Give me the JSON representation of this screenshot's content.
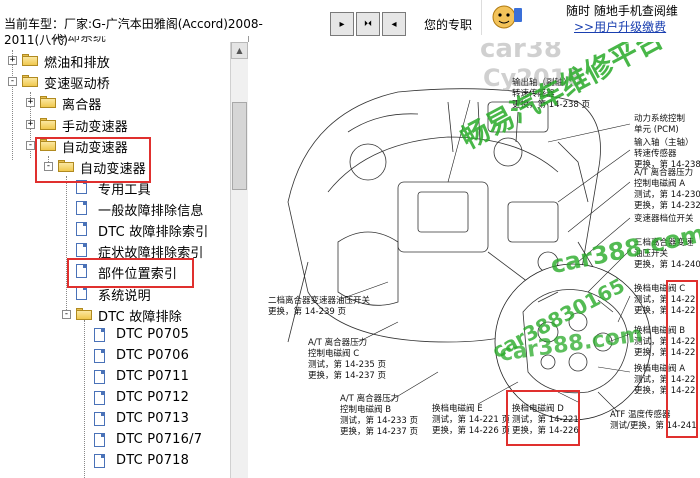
{
  "header": {
    "car_model_prefix": "当前车型：",
    "car_model_name": "厂家:G-广汽本田雅阁(Accord)2008-",
    "car_model_cont": "2011(八代)",
    "pro_text": "您的专职",
    "toolbar": [
      {
        "icon": "arrow-right-icon",
        "glyph": "▸"
      },
      {
        "icon": "double-arrow-icon",
        "glyph": "⏵⏴"
      },
      {
        "icon": "arrow-left-icon",
        "glyph": "◂"
      }
    ]
  },
  "banner": {
    "line1": "随时 随地手机查阅维",
    "link": ">>用户升级缴费"
  },
  "tree": [
    {
      "id": "fuel",
      "label": "燃油和排放",
      "type": "folder",
      "toggle": "+"
    },
    {
      "id": "drivetrain",
      "label": "变速驱动桥",
      "type": "folder",
      "toggle": "-"
    },
    {
      "id": "clutch",
      "label": "离合器",
      "type": "folder",
      "toggle": "+"
    },
    {
      "id": "manual",
      "label": "手动变速器",
      "type": "folder",
      "toggle": "+"
    },
    {
      "id": "auto",
      "label": "自动变速器",
      "type": "folder",
      "toggle": "-"
    },
    {
      "id": "auto-sub",
      "label": "自动变速器",
      "type": "folder",
      "toggle": "-"
    },
    {
      "id": "tools",
      "label": "专用工具",
      "type": "doc"
    },
    {
      "id": "general",
      "label": "一般故障排除信息",
      "type": "doc"
    },
    {
      "id": "dtc-index",
      "label": "DTC 故障排除索引",
      "type": "doc"
    },
    {
      "id": "symptom-index",
      "label": "症状故障排除索引",
      "type": "doc"
    },
    {
      "id": "parts-index",
      "label": "部件位置索引",
      "type": "doc"
    },
    {
      "id": "system",
      "label": "系统说明",
      "type": "doc"
    },
    {
      "id": "dtc-troubleshoot",
      "label": "DTC 故障排除",
      "type": "folder",
      "toggle": "-"
    },
    {
      "id": "p0705",
      "label": "DTC P0705",
      "type": "doc"
    },
    {
      "id": "p0706",
      "label": "DTC P0706",
      "type": "doc"
    },
    {
      "id": "p0711",
      "label": "DTC P0711",
      "type": "doc"
    },
    {
      "id": "p0712",
      "label": "DTC P0712",
      "type": "doc"
    },
    {
      "id": "p0713",
      "label": "DTC P0713",
      "type": "doc"
    },
    {
      "id": "p0716",
      "label": "DTC P0716/7",
      "type": "doc"
    },
    {
      "id": "p0718",
      "label": "DTC P0718",
      "type": "doc"
    }
  ],
  "diagram": {
    "labels": {
      "l1": "输出轴（副轴）\n转速传感器\n更换，第 14-238 页",
      "l2": "动力系统控制\n单元 (PCM)",
      "l3": "输入轴（主轴）\n转速传感器\n更换，第 14-238",
      "l4": "A/T 离合器压力\n控制电磁阀 A\n测试，第 14-230\n更换，第 14-232",
      "l5": "变速器档位开关",
      "l6": "三档离合器变速\n油压开关\n更换，第 14-240",
      "l7": "二档离合器变速器油压开关\n更换，第 14-239 页",
      "l8": "A/T 离合器压力\n控制电磁阀 C\n测试，第 14-235 页\n更换，第 14-237 页",
      "l9": "A/T 离合器压力\n控制电磁阀 B\n测试，第 14-233 页\n更换，第 14-237 页",
      "l10": "换档电磁阀 E\n测试，第 14-221 页\n更换，第 14-226 页",
      "l11": "换档电磁阀 D\n测试，第 14-221\n更换，第 14-226",
      "l12": "ATF 温度传感器\n测试/更换，第 14-241 页",
      "l13": "换档电磁阀 C\n测试，第 14-22\n更换，第 14-22",
      "l14": "换档电磁阀 B\n测试，第 14-22\n更换，第 14-22",
      "l15": "换档电磁阀 A\n测试，第 14-22\n更换，第 14-22"
    },
    "watermarks": {
      "w1": "car38",
      "w2": "Cy2016",
      "w3": "畅易汽车维修平台",
      "w4": "car388.com",
      "w5": "car38830165",
      "w6": "car388.com"
    }
  },
  "colors": {
    "highlight": "#e0302e",
    "link": "#1a3fb0"
  }
}
